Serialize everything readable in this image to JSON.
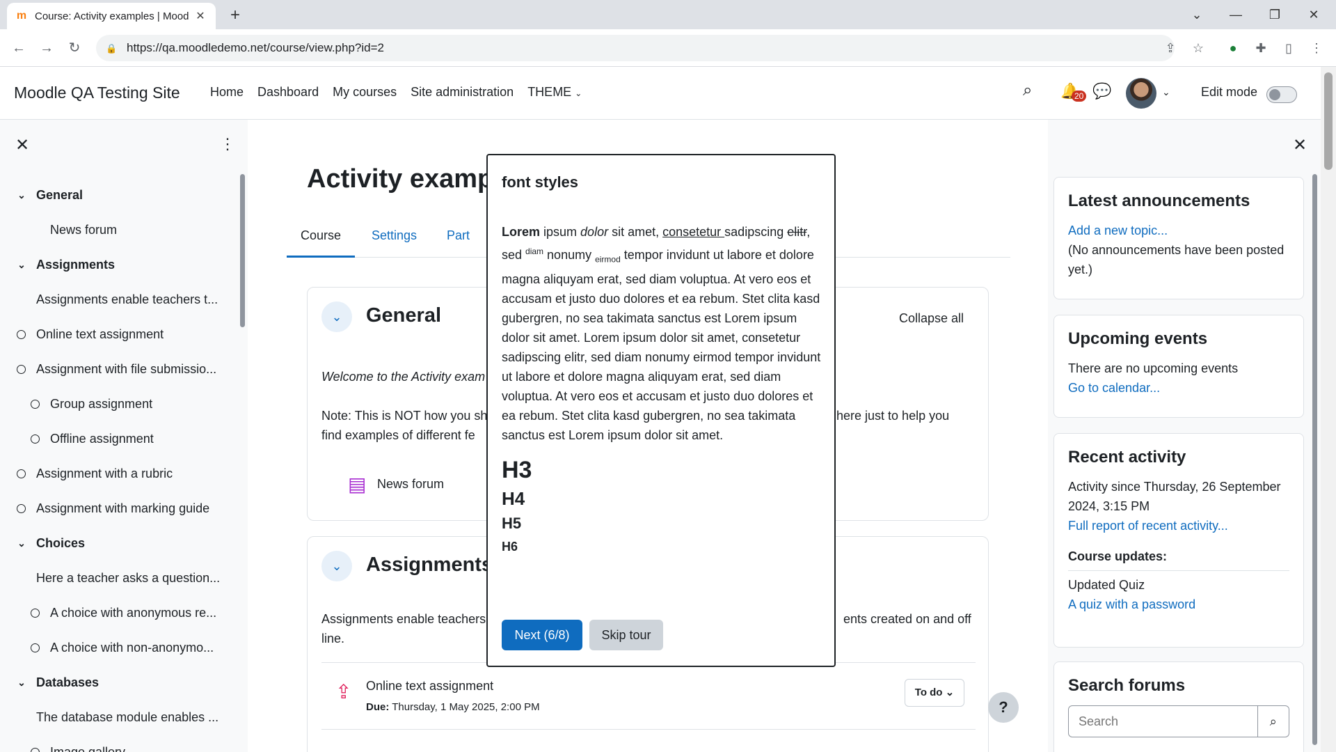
{
  "browser": {
    "tab_title": "Course: Activity examples | Mood",
    "url": "https://qa.moodledemo.net/course/view.php?id=2",
    "new_tab": "+",
    "window_controls": [
      "⌄",
      "—",
      "❐",
      "✕"
    ]
  },
  "navbar": {
    "brand": "Moodle QA Testing Site",
    "links": [
      "Home",
      "Dashboard",
      "My courses",
      "Site administration",
      "THEME"
    ],
    "notification_count": "20",
    "edit_mode_label": "Edit mode",
    "edit_mode_on": false
  },
  "left_drawer": {
    "items": [
      {
        "type": "section",
        "label": "General"
      },
      {
        "type": "item",
        "label": "News forum"
      },
      {
        "type": "section",
        "label": "Assignments"
      },
      {
        "type": "item",
        "label": "Assignments enable teachers t..."
      },
      {
        "type": "activity",
        "label": "Online text assignment"
      },
      {
        "type": "activity",
        "label": "Assignment with file submissio..."
      },
      {
        "type": "subactivity",
        "label": "Group assignment"
      },
      {
        "type": "subactivity",
        "label": "Offline assignment"
      },
      {
        "type": "activity",
        "label": "Assignment with a rubric"
      },
      {
        "type": "activity",
        "label": "Assignment with marking guide"
      },
      {
        "type": "section",
        "label": "Choices"
      },
      {
        "type": "item",
        "label": "Here a teacher asks a question..."
      },
      {
        "type": "subactivity",
        "label": "A choice with anonymous re..."
      },
      {
        "type": "subactivity",
        "label": "A choice with non-anonymo..."
      },
      {
        "type": "section",
        "label": "Databases"
      },
      {
        "type": "item",
        "label": "The database module enables ..."
      },
      {
        "type": "subactivity",
        "label": "Image gallery"
      }
    ]
  },
  "main": {
    "page_title": "Activity examp",
    "tabs": [
      "Course",
      "Settings",
      "Part"
    ],
    "general": {
      "title": "General",
      "collapse_all": "Collapse all",
      "welcome": "Welcome to the Activity exam",
      "note_left": "Note: This is NOT how you sh",
      "note_right": "here just to help you",
      "note_line2": "find examples of different fe",
      "news_forum": "News forum"
    },
    "assignments": {
      "title": "Assignments",
      "desc_left": "Assignments enable teachers",
      "desc_right": "ents created on and off",
      "desc_line2": "line.",
      "activity_name": "Online text assignment",
      "due_label": "Due:",
      "due_value": "Thursday, 1 May 2025, 2:00 PM",
      "todo": "To do"
    },
    "help": "?"
  },
  "right_drawer": {
    "announcements": {
      "title": "Latest announcements",
      "link": "Add a new topic...",
      "text": "(No announcements have been posted yet.)"
    },
    "events": {
      "title": "Upcoming events",
      "text": "There are no upcoming events",
      "link": "Go to calendar..."
    },
    "recent": {
      "title": "Recent activity",
      "since": "Activity since Thursday, 26 September 2024, 3:15 PM",
      "report_link": "Full report of recent activity...",
      "updates_title": "Course updates:",
      "update_text": "Updated Quiz",
      "update_link": "A quiz with a password"
    },
    "search": {
      "title": "Search forums",
      "placeholder": "Search"
    }
  },
  "tour": {
    "title": "font styles",
    "p_bold": "Lorem",
    "p_1": " ipsum ",
    "p_italic": "dolor",
    "p_2": " sit amet, ",
    "p_underline": "consetetur ",
    "p_3": "sadipscing ",
    "p_strike": "elitr",
    "p_4": ", sed ",
    "p_sup": "diam",
    "p_5": " nonumy ",
    "p_sub": "eirmod",
    "p_6": " tempor invidunt ut labore et dolore magna aliquyam erat, sed diam voluptua. At vero eos et accusam et justo duo dolores et ea rebum. Stet clita kasd gubergren, no sea takimata sanctus est Lorem ipsum dolor sit amet. Lorem ipsum dolor sit amet, consetetur sadipscing elitr, sed diam nonumy eirmod tempor invidunt ut labore et dolore magna aliquyam erat, sed diam voluptua. At vero eos et accusam et justo duo dolores et ea rebum. Stet clita kasd gubergren, no sea takimata sanctus est Lorem ipsum dolor sit amet.",
    "h3": "H3",
    "h4": "H4",
    "h5": "H5",
    "h6": "H6",
    "next": "Next (6/8)",
    "skip": "Skip tour"
  }
}
